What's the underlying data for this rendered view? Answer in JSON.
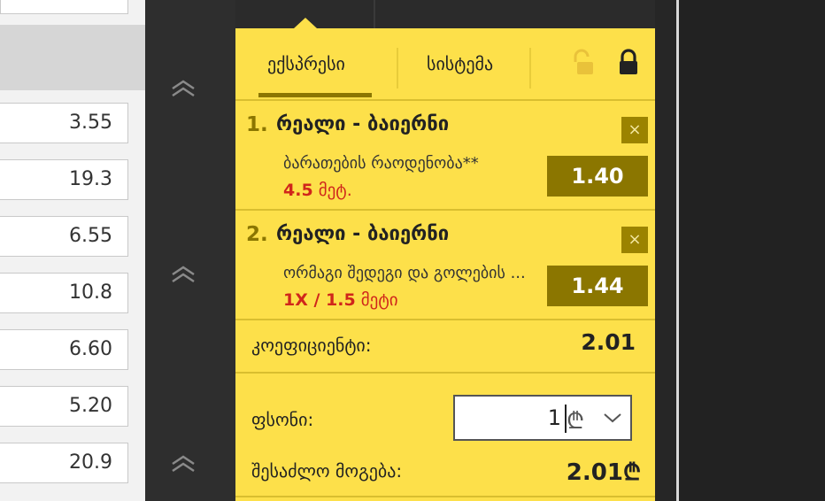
{
  "odds_column": {
    "values": [
      "3.55",
      "19.3",
      "6.55",
      "10.8",
      "6.60",
      "5.20",
      "20.9"
    ]
  },
  "gutter": {
    "icons": [
      "chevron-double-up-icon",
      "chevron-double-up-icon",
      "chevron-double-up-icon"
    ]
  },
  "betslip": {
    "tabs": [
      {
        "label": "ექსპრესი",
        "active": true
      },
      {
        "label": "სისტემა",
        "active": false
      }
    ],
    "icons": {
      "unlock": "unlock-icon",
      "lock": "lock-icon"
    },
    "bets": [
      {
        "number": "1.",
        "match": "რეალი - ბაიერნი",
        "market": "ბარათების რაოდენობა**",
        "pick_bold": "4.5",
        "pick_rest": " მეტ.",
        "odd": "1.40",
        "close": "×"
      },
      {
        "number": "2.",
        "match": "რეალი - ბაიერნი",
        "market": "ორმაგი შედეგი და გოლების ...",
        "pick_bold": "1X / 1.5",
        "pick_rest": " მეტი",
        "odd": "1.44",
        "close": "×"
      }
    ],
    "coefficient_label": "კოეფიციენტი:",
    "coefficient_value": "2.01",
    "stake_label": "ფსონი:",
    "stake_value": "1",
    "currency_sign": "₾",
    "possible_win_label": "შესაძლო მოგება:",
    "possible_win_value": "2.01₾"
  },
  "colors": {
    "slip_bg": "#fde04a",
    "accent_dark": "#8b7600",
    "pick_red": "#d0261b"
  }
}
